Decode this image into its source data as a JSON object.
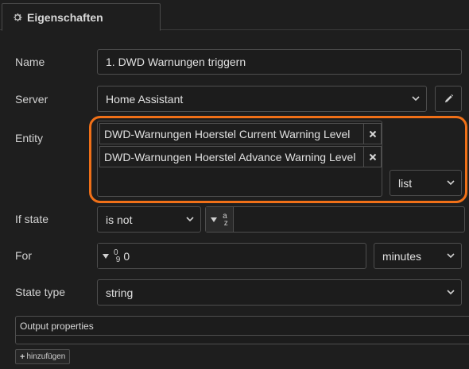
{
  "tab": {
    "title": "Eigenschaften",
    "icon": "gear-icon"
  },
  "fields": {
    "name": {
      "label": "Name",
      "value": "1. DWD Warnungen triggern"
    },
    "server": {
      "label": "Server",
      "value": "Home Assistant",
      "edit_icon": "pencil-icon"
    },
    "entity": {
      "label": "Entity",
      "items": [
        "DWD-Warnungen Hoerstel Current Warning Level",
        "DWD-Warnungen Hoerstel Advance Warning Level"
      ],
      "mode": "list"
    },
    "if_state": {
      "label": "If state",
      "operator": "is not",
      "type_indicator": "a z",
      "value": ""
    },
    "for": {
      "label": "For",
      "type_indicator": "0 9",
      "value": "0",
      "unit": "minutes"
    },
    "state_type": {
      "label": "State type",
      "value": "string"
    }
  },
  "output_properties": {
    "header": "Output properties"
  },
  "add_button": {
    "label": "hinzufügen"
  },
  "colors": {
    "highlight": "#f07018",
    "background": "#1e1e1e"
  }
}
